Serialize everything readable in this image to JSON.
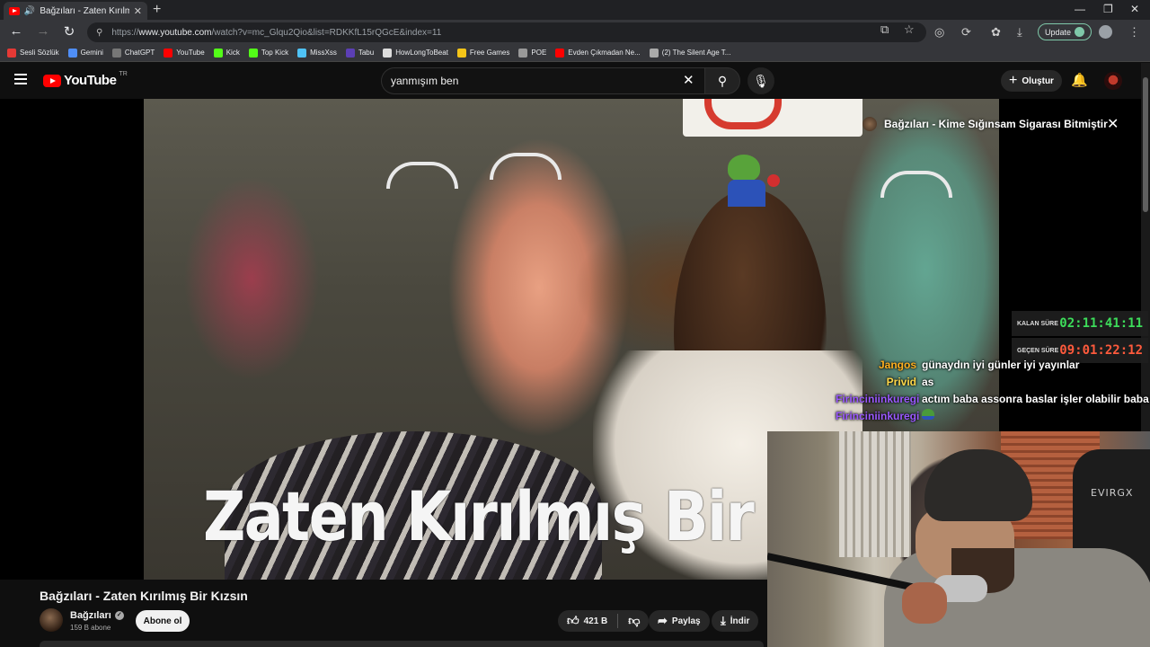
{
  "browser": {
    "tab_title": "Bağzıları - Zaten Kırılmış Bir Kızsın",
    "url_prefix": "https://",
    "url_host": "www.youtube.com",
    "url_path": "/watch?v=mc_Glqu2Qio&list=RDKKfL15rQGcE&index=11",
    "update_label": "Update",
    "bookmarks": [
      {
        "label": "Sesli Sözlük",
        "color": "#e53935"
      },
      {
        "label": "Gemini",
        "color": "#4f8ef7"
      },
      {
        "label": "ChatGPT",
        "color": "#777777"
      },
      {
        "label": "YouTube",
        "color": "#ff0000"
      },
      {
        "label": "Kick",
        "color": "#53fc18"
      },
      {
        "label": "Top Kick",
        "color": "#53fc18"
      },
      {
        "label": "MissXss",
        "color": "#4fc3f7"
      },
      {
        "label": "Tabu",
        "color": "#5c3fb5"
      },
      {
        "label": "HowLongToBeat",
        "color": "#dddddd"
      },
      {
        "label": "Free Games",
        "color": "#f5c518"
      },
      {
        "label": "POE",
        "color": "#999999"
      },
      {
        "label": "Evden Çıkmadan Ne...",
        "color": "#ff0000"
      },
      {
        "label": "(2) The Silent Age T...",
        "color": "#aaaaaa"
      }
    ]
  },
  "youtube": {
    "logo_text": "YouTube",
    "country_code": "TR",
    "search_value": "yanmışım ben",
    "create_label": "Oluştur"
  },
  "video": {
    "overlay_text": "Zaten Kırılmış Bir K",
    "up_next_title": "Bağzıları - Kime Sığınsam Sigarası Bitmiştir",
    "title": "Bağzıları - Zaten Kırılmış Bir Kızsın",
    "channel_name": "Bağzıları",
    "subscribers": "159 B abone",
    "subscribe_label": "Abone ol",
    "likes": "421 B",
    "share_label": "Paylaş",
    "download_label": "İndir"
  },
  "overlay": {
    "timers": [
      {
        "label": "KALAN SÜRE",
        "value": "02:11:41:11",
        "color": "#3ddc5a"
      },
      {
        "label": "GEÇEN SÜRE",
        "value": "09:01:22:12",
        "color": "#ff5a3c"
      }
    ],
    "chat": [
      {
        "user": "Jangos",
        "message": "günaydın iyi günler iyi yayınlar",
        "color": "#ffb020"
      },
      {
        "user": "Privid",
        "message": "as",
        "color": "#ffd84a"
      },
      {
        "user": "Firinciniinkuregi",
        "message": "actım baba assonra baslar işler olabilir baba",
        "color": "#9b59ff"
      },
      {
        "user": "Firinciniinkuregi",
        "message": "",
        "color": "#9b59ff"
      }
    ],
    "chair_brand": "EVIRGX"
  }
}
